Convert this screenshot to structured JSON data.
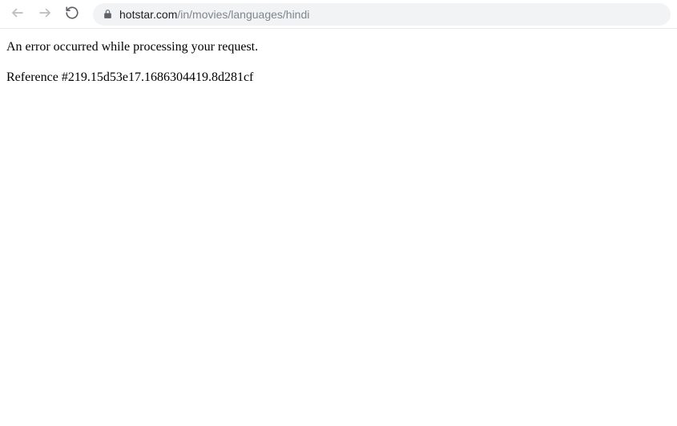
{
  "toolbar": {
    "url_domain": "hotstar.com",
    "url_path": "/in/movies/languages/hindi"
  },
  "page": {
    "error_message": "An error occurred while processing your request.",
    "reference_line": "Reference #219.15d53e17.1686304419.8d281cf"
  }
}
